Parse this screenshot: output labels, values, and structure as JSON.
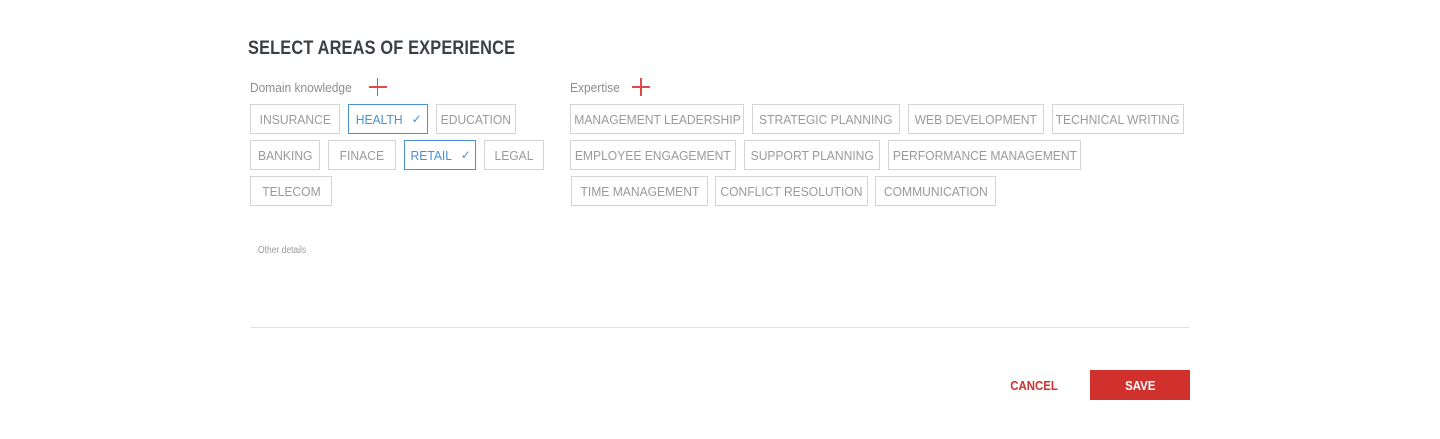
{
  "title": "SELECT AREAS OF EXPERIENCE",
  "domain": {
    "label": "Domain knowledge",
    "chips": [
      {
        "label": "INSURANCE",
        "selected": false
      },
      {
        "label": "HEALTH",
        "selected": true
      },
      {
        "label": "EDUCATION",
        "selected": false
      },
      {
        "label": "BANKING",
        "selected": false
      },
      {
        "label": "FINACE",
        "selected": false
      },
      {
        "label": "RETAIL",
        "selected": true
      },
      {
        "label": "LEGAL",
        "selected": false
      },
      {
        "label": "TELECOM",
        "selected": false
      }
    ]
  },
  "expertise": {
    "label": "Expertise",
    "chips": [
      {
        "label": "MANAGEMENT LEADERSHIP",
        "selected": false
      },
      {
        "label": "STRATEGIC PLANNING",
        "selected": false
      },
      {
        "label": "WEB DEVELOPMENT",
        "selected": false
      },
      {
        "label": "TECHNICAL WRITING",
        "selected": false
      },
      {
        "label": "EMPLOYEE ENGAGEMENT",
        "selected": false
      },
      {
        "label": "SUPPORT PLANNING",
        "selected": false
      },
      {
        "label": "PERFORMANCE MANAGEMENT",
        "selected": false
      },
      {
        "label": "TIME MANAGEMENT",
        "selected": false
      },
      {
        "label": "CONFLICT RESOLUTION",
        "selected": false
      },
      {
        "label": "COMMUNICATION",
        "selected": false
      }
    ]
  },
  "other_details": {
    "label": "Other details",
    "value": ""
  },
  "actions": {
    "cancel": "CANCEL",
    "save": "SAVE"
  },
  "colors": {
    "accent": "#d0312d",
    "selected": "#4a90d9",
    "plus": "#e04a4a"
  },
  "icons": {
    "add": "plus-icon",
    "selected": "check-icon"
  }
}
